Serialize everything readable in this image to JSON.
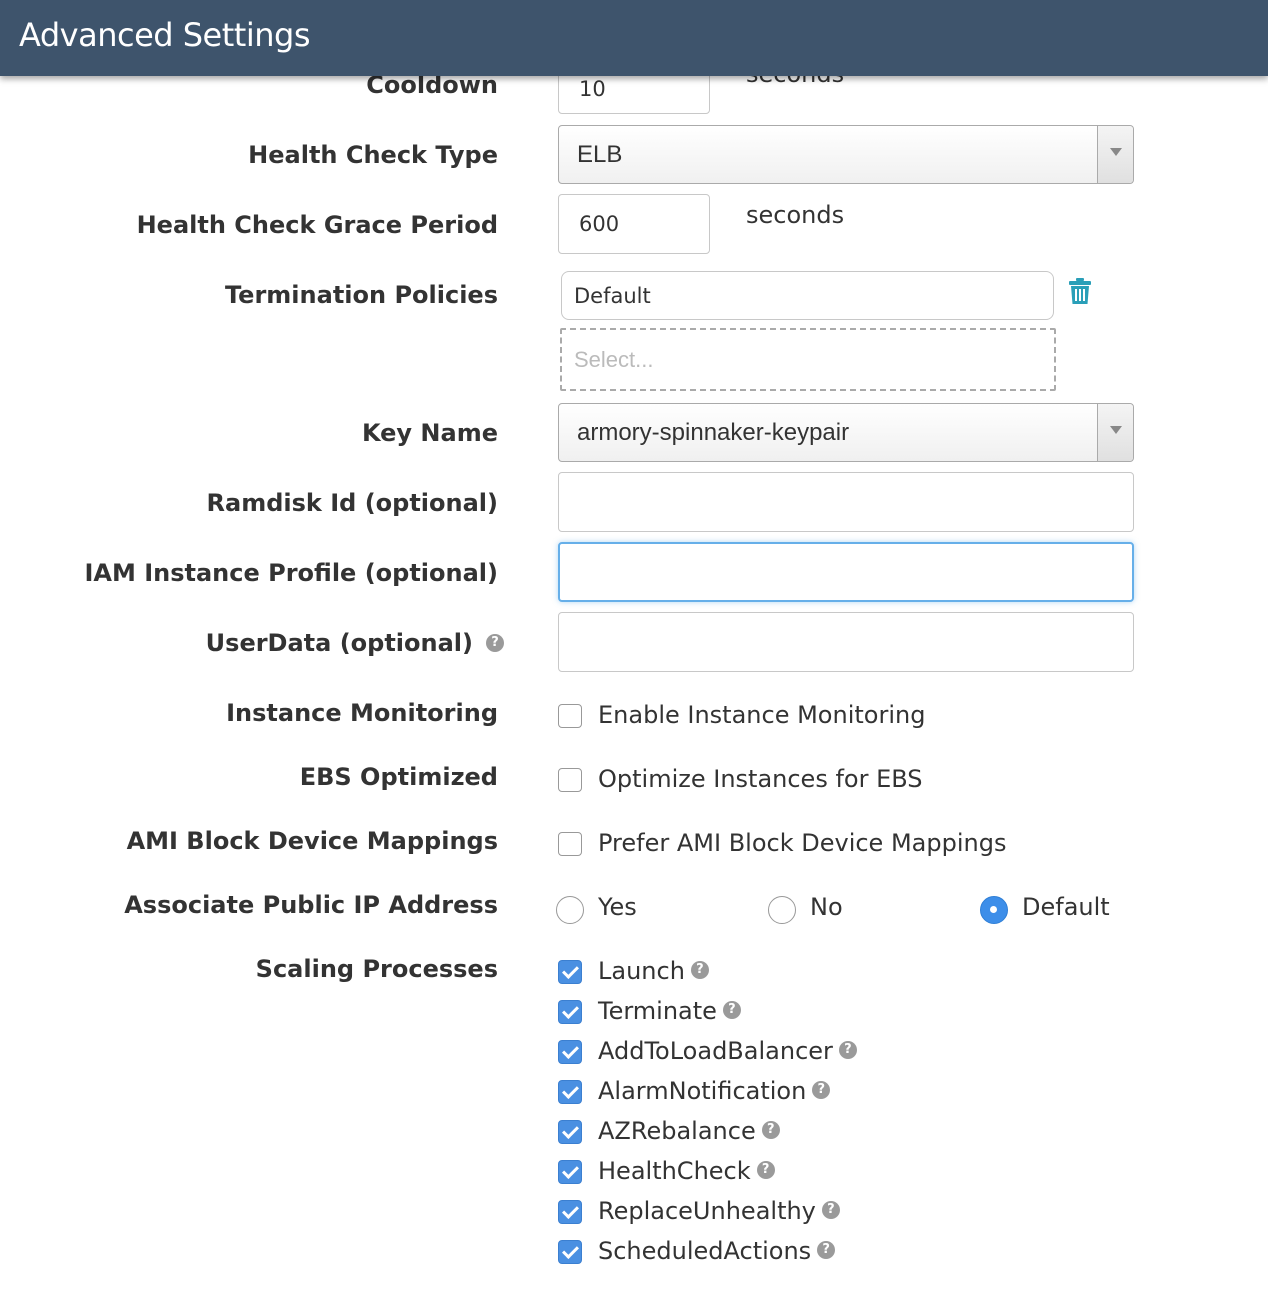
{
  "header": {
    "title": "Advanced Settings"
  },
  "cooldown": {
    "label": "Cooldown",
    "value": "10",
    "suffix": "seconds"
  },
  "health_check_type": {
    "label": "Health Check Type",
    "selected": "ELB"
  },
  "health_check_grace_period": {
    "label": "Health Check Grace Period",
    "value": "600",
    "suffix": "seconds"
  },
  "termination_policies": {
    "label": "Termination Policies",
    "value": "Default",
    "select_placeholder": "Select..."
  },
  "key_name": {
    "label": "Key Name",
    "selected": "armory-spinnaker-keypair"
  },
  "ramdisk_id": {
    "label": "Ramdisk Id (optional)",
    "value": ""
  },
  "iam_instance_profile": {
    "label": "IAM Instance Profile (optional)",
    "value": ""
  },
  "user_data": {
    "label": "UserData (optional)",
    "value": ""
  },
  "instance_monitoring": {
    "label": "Instance Monitoring",
    "option": "Enable Instance Monitoring",
    "checked": false
  },
  "ebs_optimized": {
    "label": "EBS Optimized",
    "option": "Optimize Instances for EBS",
    "checked": false
  },
  "ami_block_device_mappings": {
    "label": "AMI Block Device Mappings",
    "option": "Prefer AMI Block Device Mappings",
    "checked": false
  },
  "associate_public_ip": {
    "label": "Associate Public IP Address",
    "options": [
      "Yes",
      "No",
      "Default"
    ],
    "selected": "Default"
  },
  "scaling_processes": {
    "label": "Scaling Processes",
    "items": [
      {
        "name": "Launch",
        "checked": true
      },
      {
        "name": "Terminate",
        "checked": true
      },
      {
        "name": "AddToLoadBalancer",
        "checked": true
      },
      {
        "name": "AlarmNotification",
        "checked": true
      },
      {
        "name": "AZRebalance",
        "checked": true
      },
      {
        "name": "HealthCheck",
        "checked": true
      },
      {
        "name": "ReplaceUnhealthy",
        "checked": true
      },
      {
        "name": "ScheduledActions",
        "checked": true
      }
    ]
  },
  "colors": {
    "header_bg": "#3e546c",
    "accent": "#4a90e2",
    "trash": "#2a9fb8"
  },
  "icons": {
    "help": "question-circle-icon",
    "trash": "trash-icon",
    "dropdown": "chevron-down-icon"
  }
}
